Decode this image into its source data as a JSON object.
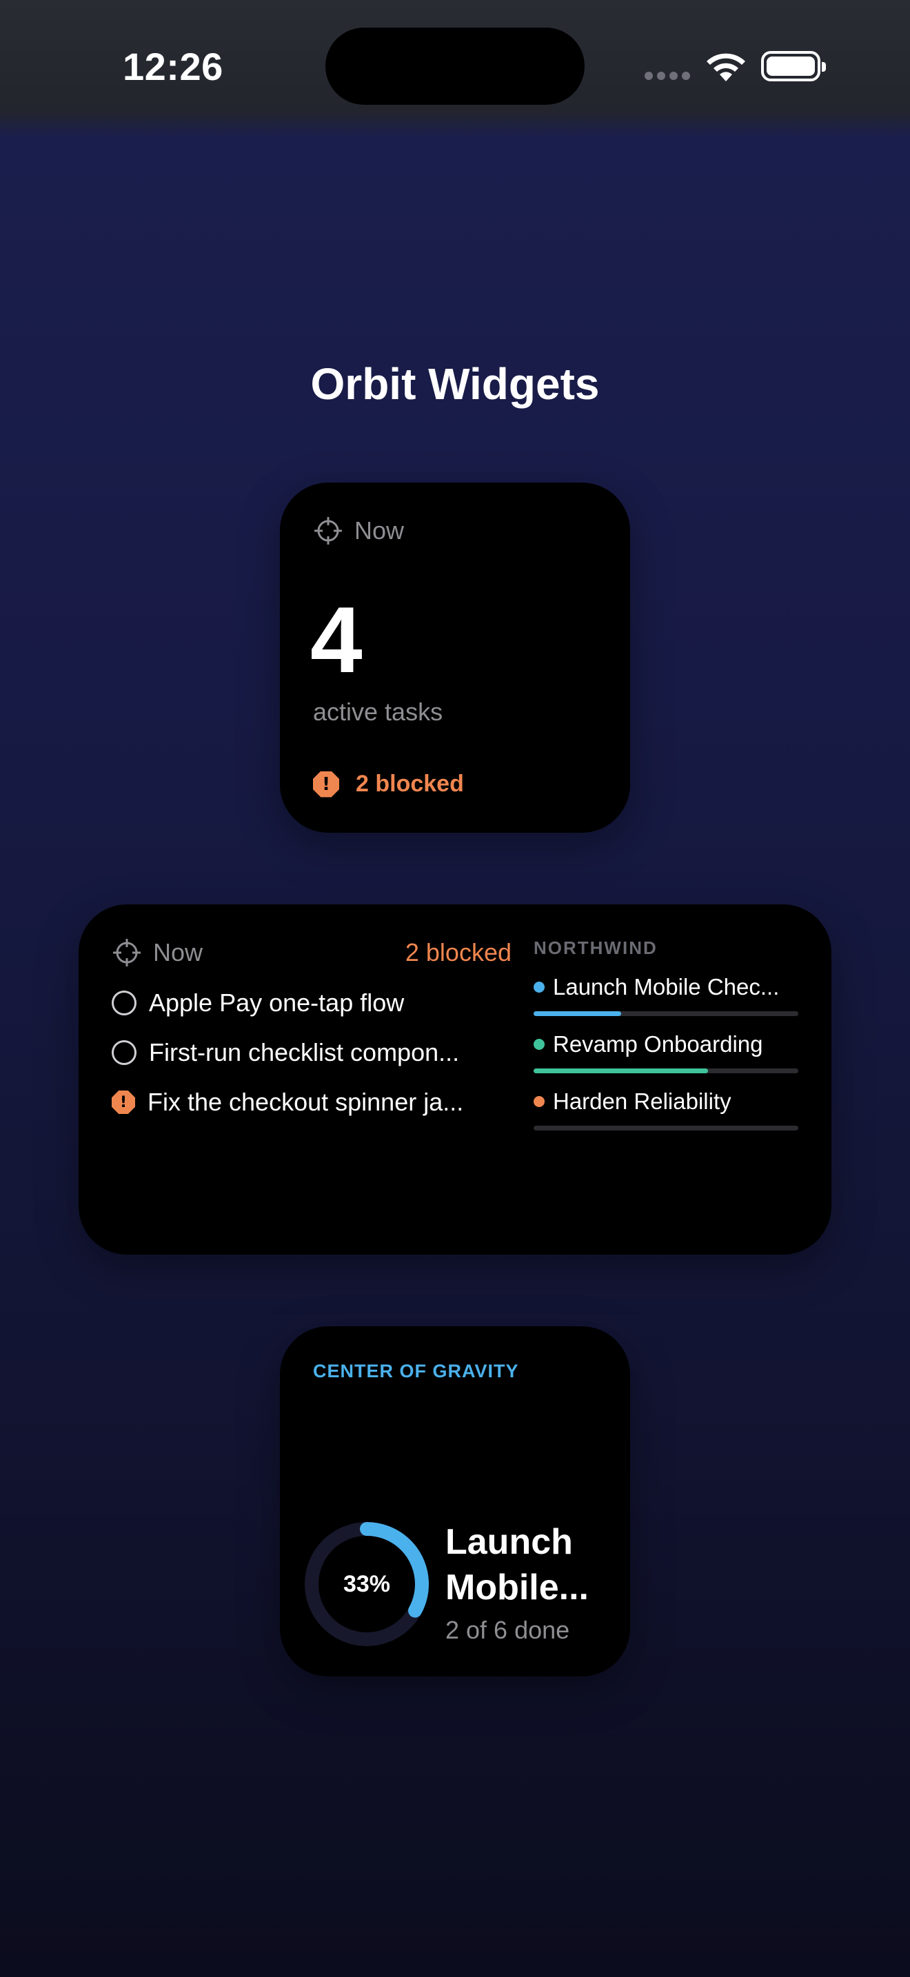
{
  "status_bar": {
    "time": "12:26"
  },
  "page": {
    "title": "Orbit Widgets"
  },
  "small_widget": {
    "header": "Now",
    "count": "4",
    "subtitle": "active tasks",
    "blocked": "2 blocked",
    "blocked_icon": "!"
  },
  "medium_widget": {
    "header": "Now",
    "blocked": "2 blocked",
    "tasks": [
      {
        "label": "Apple Pay one-tap flow",
        "status": "open"
      },
      {
        "label": "First-run checklist compon...",
        "status": "open"
      },
      {
        "label": "Fix the checkout spinner ja...",
        "status": "blocked",
        "icon": "!"
      }
    ],
    "projects_label": "NORTHWIND",
    "projects": [
      {
        "name": "Launch Mobile Chec...",
        "color": "#4bb1ec",
        "progress": 0.33
      },
      {
        "name": "Revamp Onboarding",
        "color": "#3fc49a",
        "progress": 0.66
      },
      {
        "name": "Harden Reliability",
        "color": "#f0864f",
        "progress": 0.0
      }
    ]
  },
  "gravity_widget": {
    "label": "CENTER OF GRAVITY",
    "percent": "33%",
    "progress": 0.33,
    "title_line1": "Launch",
    "title_line2": "Mobile...",
    "subtitle": "2 of 6 done"
  },
  "colors": {
    "accent_blue": "#4bb1ec",
    "accent_orange": "#f0864f",
    "accent_green": "#3fc49a"
  }
}
